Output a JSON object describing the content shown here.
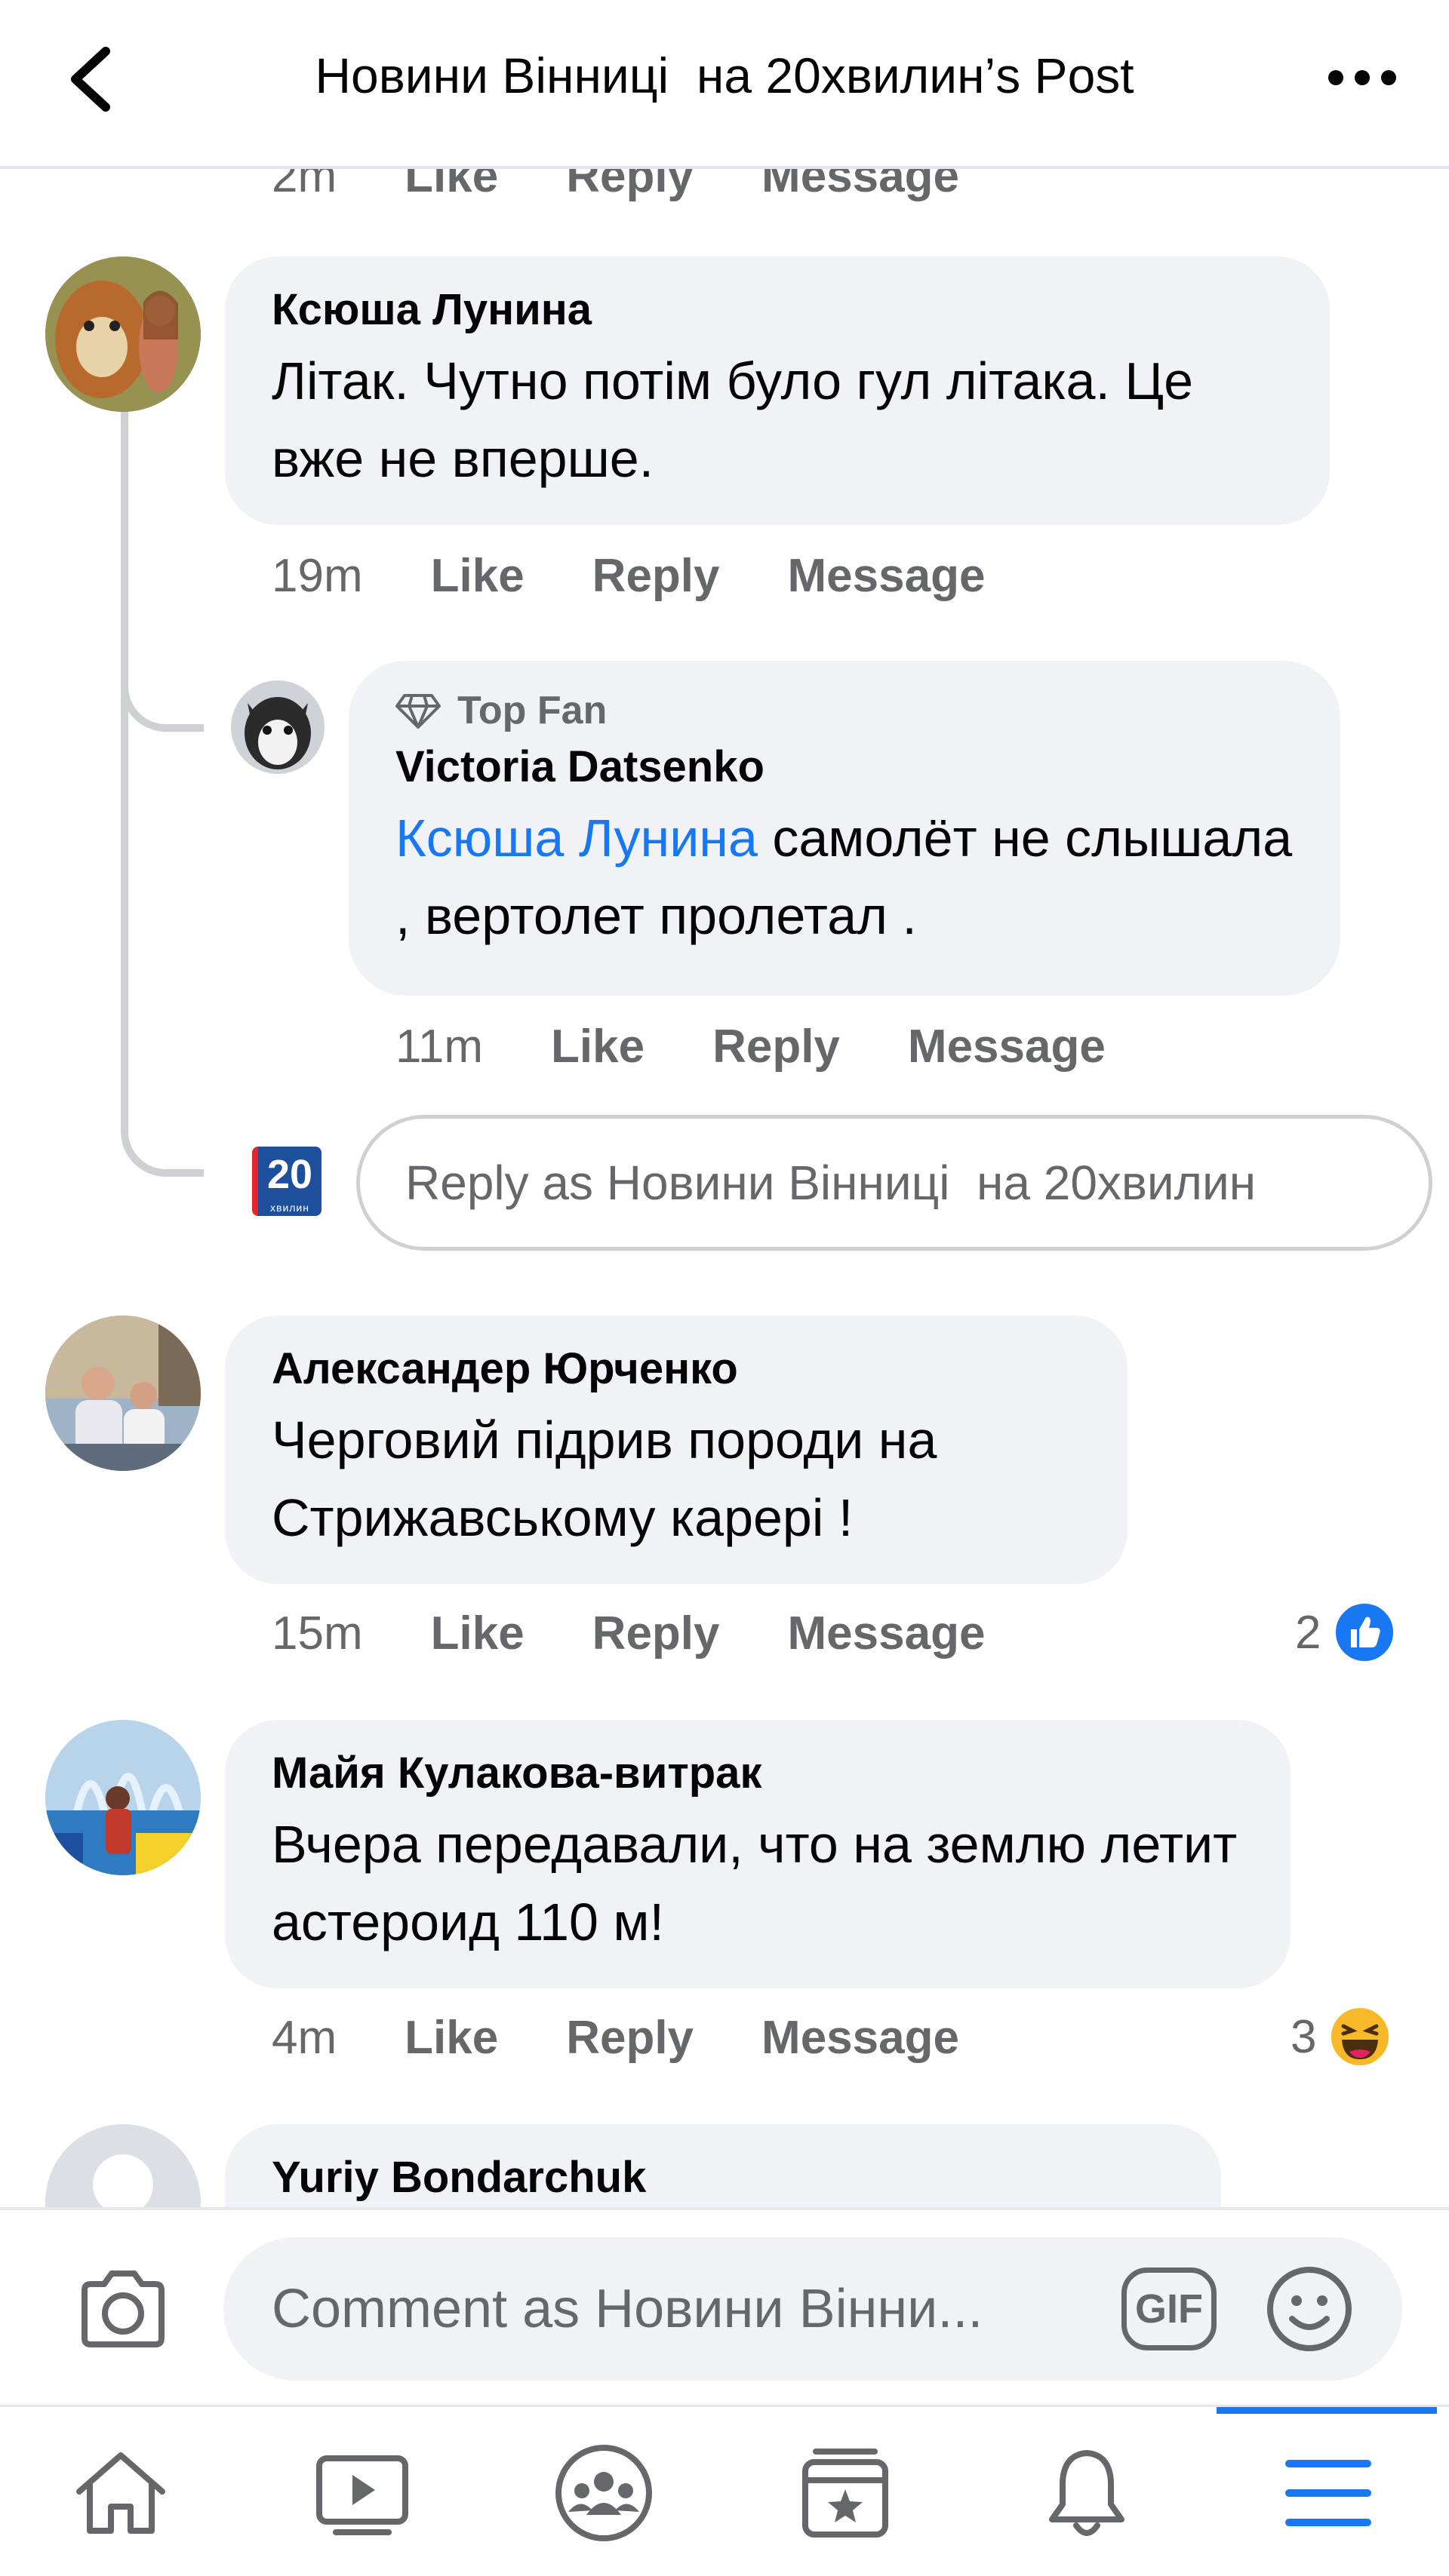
{
  "header": {
    "title": "Новини Вінниці  на 20хвилин’s Post",
    "back_icon": "chevron-left-icon",
    "more_icon": "more-horizontal-icon"
  },
  "top_meta": {
    "time": "2m",
    "like": "Like",
    "reply": "Reply",
    "message": "Message"
  },
  "comments": [
    {
      "author": "Ксюша Лунина",
      "text": "Літак. Чутно потім було гул літака. Це вже не вперше.",
      "time": "19m",
      "like": "Like",
      "reply": "Reply",
      "message": "Message"
    },
    {
      "author": "Александер Юрченко",
      "text": "Черговий підрив породи на Стрижавському карері !",
      "time": "15m",
      "like": "Like",
      "reply": "Reply",
      "message": "Message",
      "reaction_count": "2",
      "reaction_icon": "like-reaction-icon"
    },
    {
      "author": "Майя Кулакова-витрак",
      "text": "Вчера передавали, что на землю летит астероид 110 м!",
      "time": "4m",
      "like": "Like",
      "reply": "Reply",
      "message": "Message",
      "reaction_count": "3",
      "reaction_icon": "haha-reaction-icon"
    },
    {
      "author": "Yuriy Bondarchuk"
    }
  ],
  "reply": {
    "badge": "Top Fan",
    "author": "Victoria Datsenko",
    "mention": "Ксюша Лунина",
    "text": " самолёт не слышала , вертолет пролетал .",
    "time": "11m",
    "like": "Like",
    "reply": "Reply",
    "message": "Message"
  },
  "reply_input": {
    "placeholder": "Reply as Новини Вінниці  на 20хвилин",
    "page_badge": "20",
    "page_badge_sub": "хвилин"
  },
  "composer": {
    "placeholder": "Comment as Новини Вінни...",
    "gif_label": "GIF",
    "camera_icon": "camera-icon",
    "emoji_icon": "smiley-icon"
  },
  "tabs": [
    {
      "name": "home",
      "icon": "home-icon"
    },
    {
      "name": "watch",
      "icon": "video-icon"
    },
    {
      "name": "groups",
      "icon": "groups-icon"
    },
    {
      "name": "pages",
      "icon": "pages-icon"
    },
    {
      "name": "notifications",
      "icon": "bell-icon"
    },
    {
      "name": "menu",
      "icon": "menu-icon",
      "active": true
    }
  ],
  "colors": {
    "accent": "#1877f2",
    "bubble": "#f0f2f5",
    "secondary_text": "#65676b"
  }
}
